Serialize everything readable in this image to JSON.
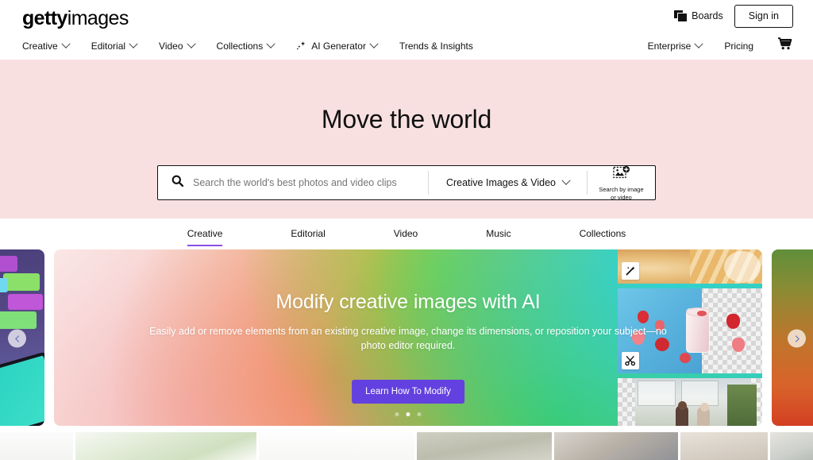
{
  "brand": {
    "logo_bold": "getty",
    "logo_regular": "images",
    "accent_purple": "#8a4fe6",
    "cta_purple": "#6340e0",
    "hero_bg": "#f8e0e1"
  },
  "header": {
    "boards_label": "Boards",
    "signin_label": "Sign in",
    "nav_left": [
      {
        "label": "Creative",
        "has_dropdown": true,
        "icon": "chevron-down-icon"
      },
      {
        "label": "Editorial",
        "has_dropdown": true,
        "icon": "chevron-down-icon"
      },
      {
        "label": "Video",
        "has_dropdown": true,
        "icon": "chevron-down-icon"
      },
      {
        "label": "Collections",
        "has_dropdown": true,
        "icon": "chevron-down-icon"
      },
      {
        "label": "AI Generator",
        "has_dropdown": true,
        "icon": "sparkle-icon"
      },
      {
        "label": "Trends & Insights",
        "has_dropdown": false,
        "icon": ""
      }
    ],
    "nav_right": [
      {
        "label": "Enterprise",
        "has_dropdown": true,
        "icon": "chevron-down-icon"
      },
      {
        "label": "Pricing",
        "has_dropdown": false,
        "icon": ""
      }
    ],
    "cart_icon": "shopping-cart-icon",
    "boards_icon": "boards-stack-icon"
  },
  "hero": {
    "title": "Move the world",
    "search": {
      "placeholder": "Search the world's best photos and video clips",
      "value": "",
      "icon": "search-icon",
      "type_selector": "Creative Images & Video",
      "type_icon": "chevron-down-icon",
      "image_search_line1": "Search by image",
      "image_search_line2": "or video",
      "image_search_icon": "image-upload-icon"
    }
  },
  "tabs": [
    {
      "label": "Creative",
      "active": true
    },
    {
      "label": "Editorial",
      "active": false
    },
    {
      "label": "Video",
      "active": false
    },
    {
      "label": "Music",
      "active": false
    },
    {
      "label": "Collections",
      "active": false
    }
  ],
  "carousel": {
    "prev_arrow_icon": "chevron-left-icon",
    "next_arrow_icon": "chevron-right-icon",
    "slide": {
      "headline": "Modify creative images with AI",
      "subtext": "Easily add or remove elements from an existing creative image, change its dimensions, or reposition your subject—no photo editor required.",
      "cta_label": "Learn How To Modify"
    },
    "dots": [
      {
        "active": false
      },
      {
        "active": true
      },
      {
        "active": false
      }
    ],
    "thumbnails": [
      {
        "name": "pie-photo",
        "tool_icon": "magic-wand-icon"
      },
      {
        "name": "strawberry-smoothie-photo",
        "tool_icon": "scissors-icon"
      },
      {
        "name": "couple-outdoors-photo",
        "tool_icon": ""
      }
    ]
  }
}
